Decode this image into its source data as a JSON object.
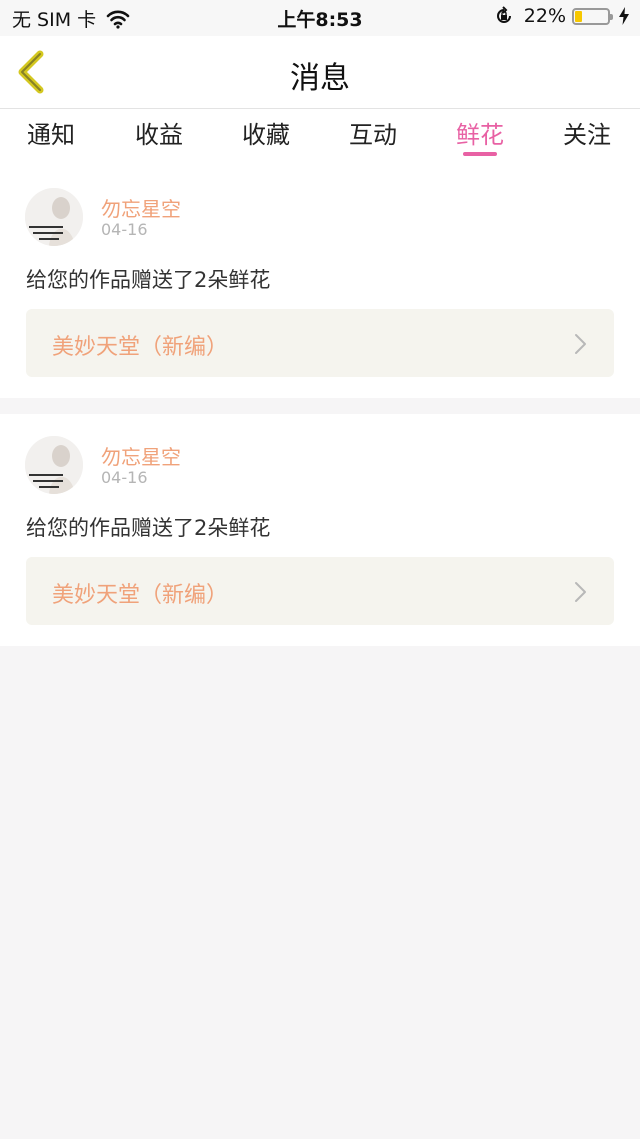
{
  "status_bar": {
    "carrier": "无 SIM 卡",
    "time": "上午8:53",
    "battery_text": "22%",
    "battery_level": 0.22,
    "icons": [
      "wifi-icon",
      "orientation-lock-icon",
      "battery-icon",
      "charging-bolt-icon"
    ]
  },
  "nav": {
    "title": "消息",
    "back_icon": "chevron-left-icon"
  },
  "tabs": [
    {
      "label": "通知"
    },
    {
      "label": "收益"
    },
    {
      "label": "收藏"
    },
    {
      "label": "互动"
    },
    {
      "label": "鲜花",
      "active": true
    },
    {
      "label": "关注"
    }
  ],
  "messages": [
    {
      "username": "勿忘星空",
      "date": "04-16",
      "text": "给您的作品赠送了2朵鲜花",
      "work_title": "美妙天堂（新编）"
    },
    {
      "username": "勿忘星空",
      "date": "04-16",
      "text": "给您的作品赠送了2朵鲜花",
      "work_title": "美妙天堂（新编）"
    }
  ],
  "colors": {
    "accent": "#e861a4",
    "username": "#f0a27a",
    "back_arrow": "#d4c820",
    "background": "#f6f5f6"
  }
}
